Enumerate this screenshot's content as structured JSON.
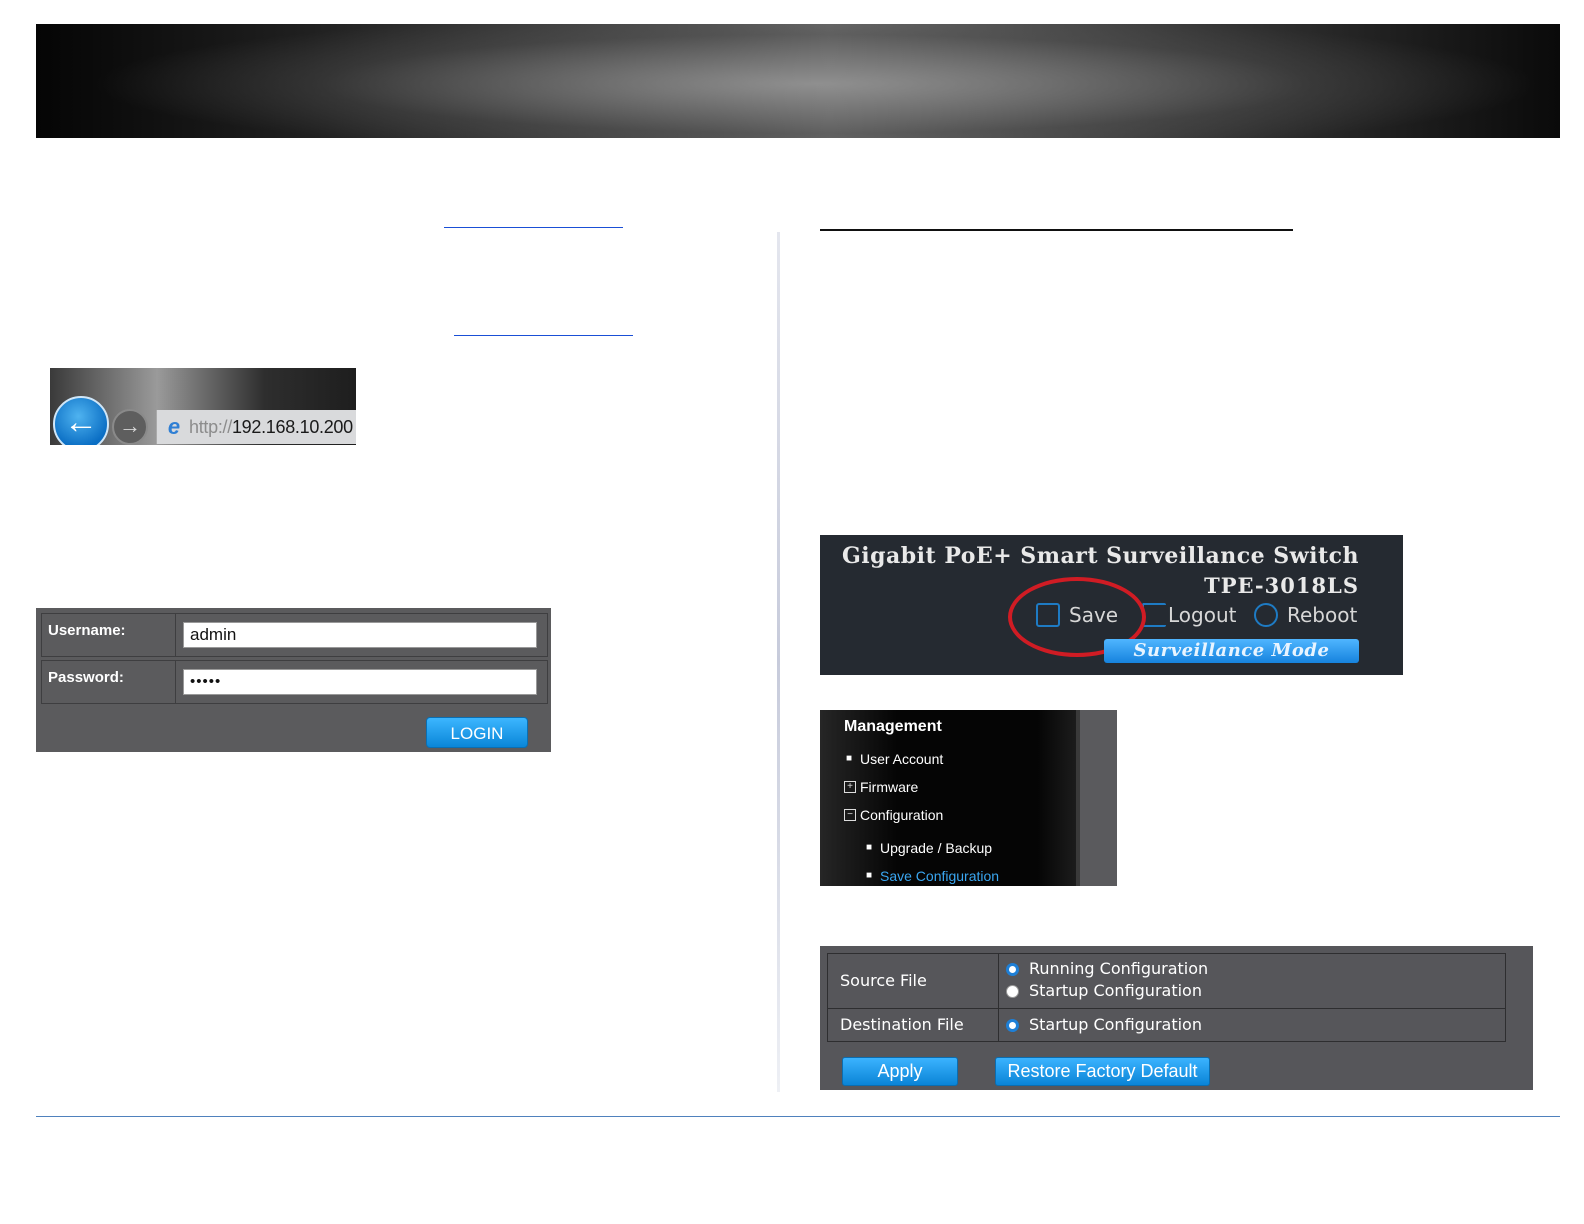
{
  "address_bar": {
    "protocol": "http://",
    "host": "192.168.10.200"
  },
  "login": {
    "username_label": "Username:",
    "username_value": "admin",
    "password_label": "Password:",
    "password_value": "•••••",
    "login_button": "LOGIN"
  },
  "switch_header": {
    "title": "Gigabit PoE+ Smart Surveillance Switch",
    "model": "TPE-3018LS",
    "save": "Save",
    "logout": "Logout",
    "reboot": "Reboot",
    "mode_button": "Surveillance Mode",
    "highlight_color": "#d01c24"
  },
  "menu": {
    "heading": "Management",
    "items": [
      "User Account",
      "Firmware",
      "Configuration",
      "Upgrade / Backup",
      "Save Configuration"
    ]
  },
  "save_config": {
    "source_label": "Source File",
    "source_options": [
      "Running Configuration",
      "Startup Configuration"
    ],
    "destination_label": "Destination File",
    "destination_option": "Startup Configuration",
    "apply_button": "Apply",
    "restore_button": "Restore Factory Default"
  }
}
